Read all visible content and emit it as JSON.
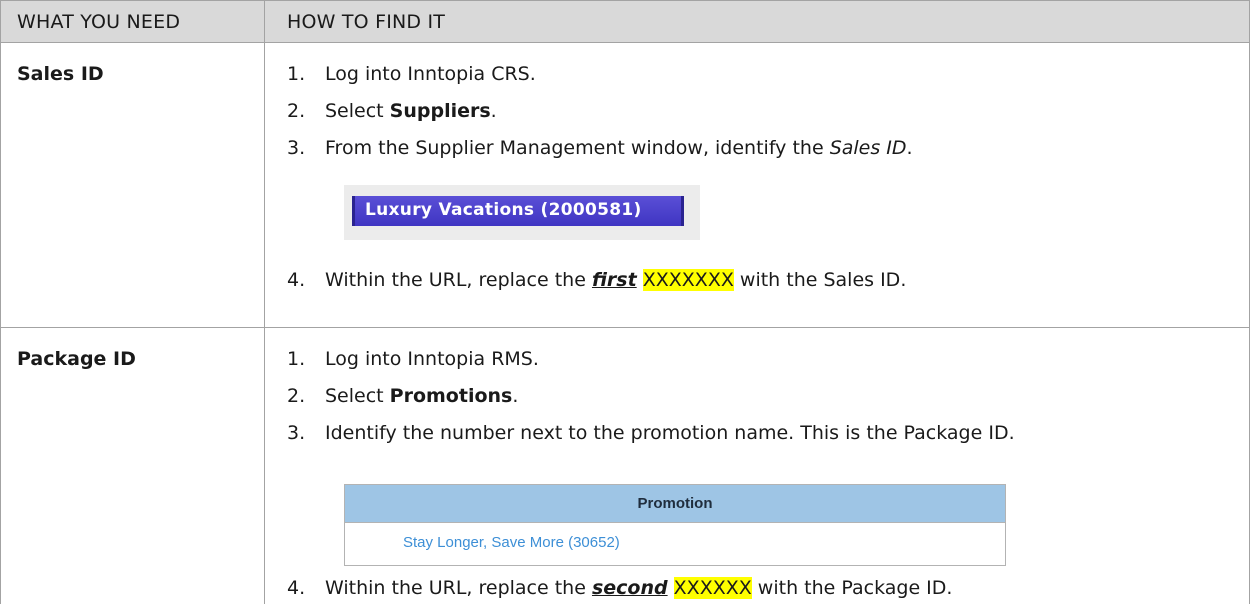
{
  "header": {
    "col1": "WHAT YOU NEED",
    "col2": "HOW TO FIND IT"
  },
  "rows": [
    {
      "label": "Sales ID",
      "steps": [
        {
          "num": "1.",
          "before": "Log into Inntopia CRS.",
          "bold": "",
          "after": ""
        },
        {
          "num": "2.",
          "before": "Select ",
          "bold": "Suppliers",
          "after": "."
        },
        {
          "num": "3.",
          "before": "From the Supplier Management window, identify the ",
          "italic": "Sales ID",
          "after": "."
        },
        {
          "num": "4.",
          "before": "Within the URL, replace the ",
          "emph": "first",
          "mid": " ",
          "highlight": "XXXXXXX",
          "after": " with the Sales ID."
        }
      ],
      "image_text": "Luxury Vacations (2000581)"
    },
    {
      "label": "Package ID",
      "steps": [
        {
          "num": "1.",
          "before": "Log into Inntopia RMS.",
          "bold": "",
          "after": ""
        },
        {
          "num": "2.",
          "before": "Select ",
          "bold": "Promotions",
          "after": "."
        },
        {
          "num": "3.",
          "before": "Identify the number next to the promotion name. This is the Package ID.",
          "bold": "",
          "after": ""
        },
        {
          "num": "4.",
          "before": "Within the URL, replace the ",
          "emph": "second",
          "mid": " ",
          "highlight": "XXXXXX",
          "after": " with the Package ID."
        }
      ],
      "image_table": {
        "header": "Promotion",
        "row": "Stay Longer, Save More (30652)"
      }
    }
  ],
  "colors": {
    "header_bg": "#d9d9d9",
    "highlight": "#ffff00",
    "sales_banner": "#4a40cc",
    "promo_header": "#9ec5e5",
    "promo_link": "#3d8fd6"
  }
}
